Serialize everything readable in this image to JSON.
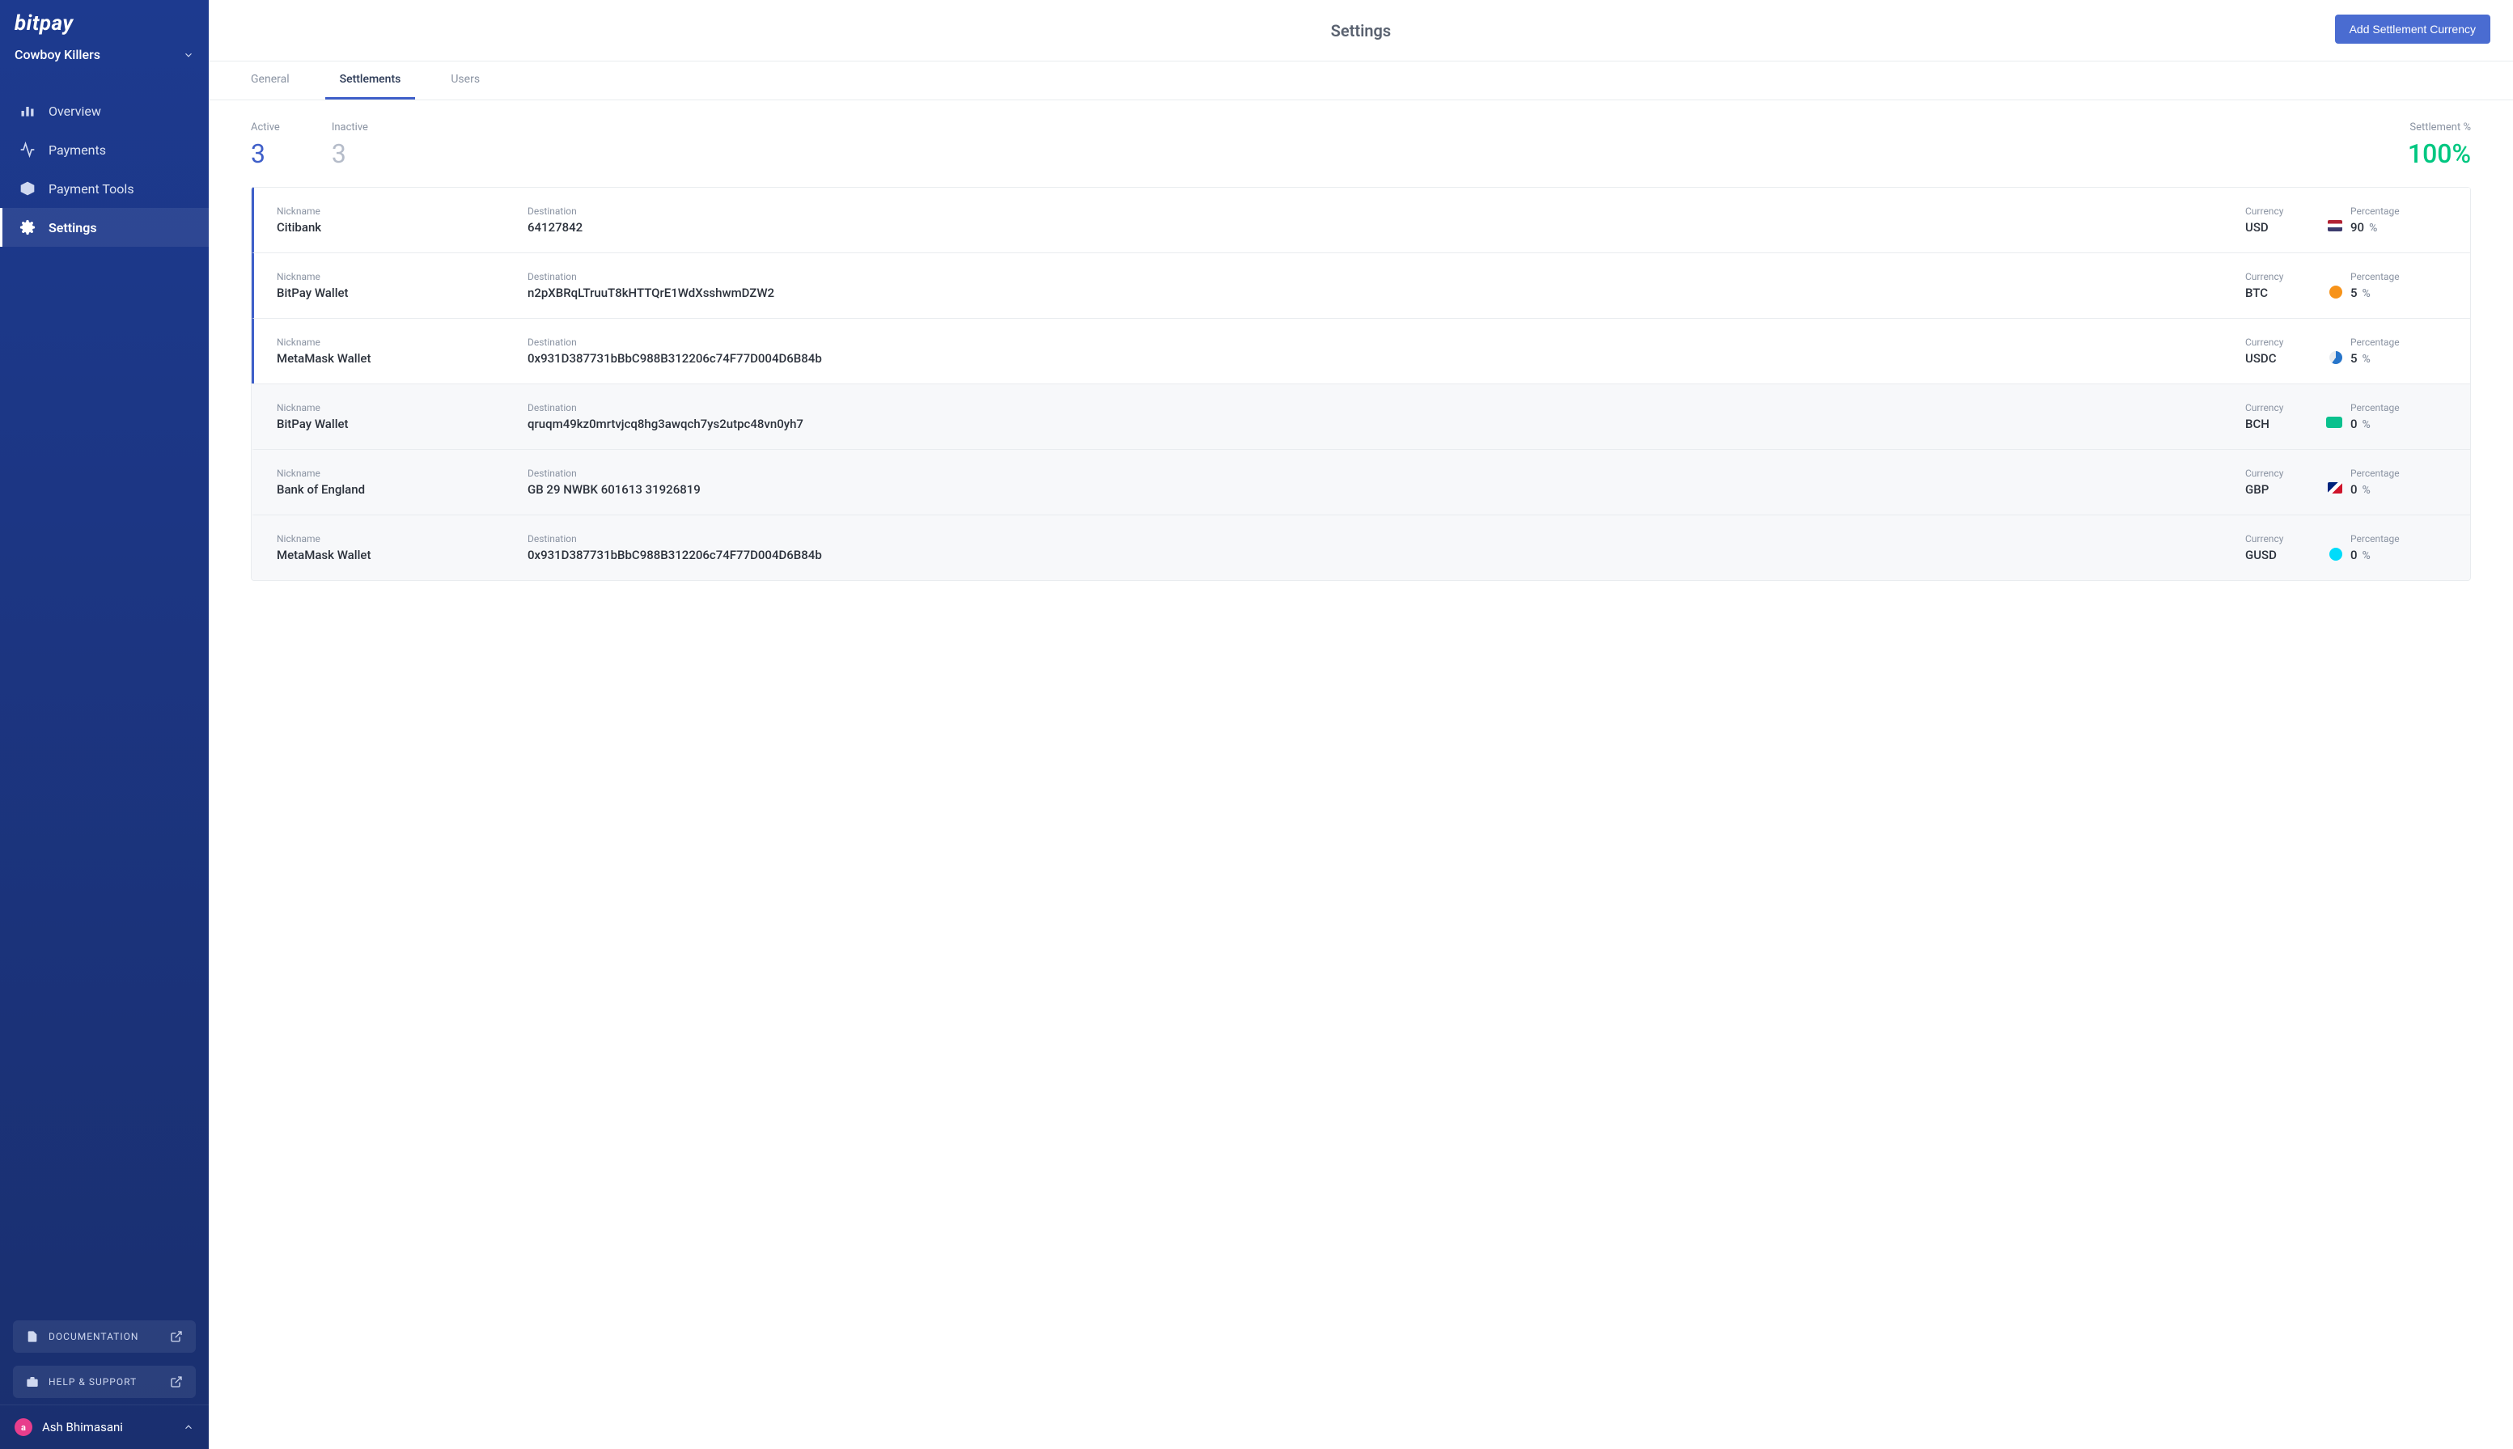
{
  "brand": "bitpay",
  "org": {
    "name": "Cowboy Killers"
  },
  "nav": {
    "overview": "Overview",
    "payments": "Payments",
    "payment_tools": "Payment Tools",
    "settings": "Settings"
  },
  "side": {
    "documentation": "DOCUMENTATION",
    "help": "HELP & SUPPORT"
  },
  "user": {
    "name": "Ash Bhimasani",
    "initial": "a"
  },
  "header": {
    "title": "Settings",
    "primary_button": "Add Settlement Currency"
  },
  "tabs": {
    "general": "General",
    "settlements": "Settlements",
    "users": "Users"
  },
  "stats": {
    "active_label": "Active",
    "active_value": "3",
    "inactive_label": "Inactive",
    "inactive_value": "3",
    "pct_label": "Settlement %",
    "pct_value": "100%"
  },
  "col": {
    "nickname": "Nickname",
    "destination": "Destination",
    "currency": "Currency",
    "percentage": "Percentage",
    "pct_sign": "%"
  },
  "rows": [
    {
      "active": true,
      "nickname": "Citibank",
      "destination": "64127842",
      "currency": "USD",
      "icon": "flag-us",
      "percentage": "90"
    },
    {
      "active": true,
      "nickname": "BitPay Wallet",
      "destination": "n2pXBRqLTruuT8kHTTQrE1WdXsshwmDZW2",
      "currency": "BTC",
      "icon": "ic-btc",
      "percentage": "5"
    },
    {
      "active": true,
      "nickname": "MetaMask Wallet",
      "destination": "0x931D387731bBbC988B312206c74F77D004D6B84b",
      "currency": "USDC",
      "icon": "ic-usdc",
      "percentage": "5"
    },
    {
      "active": false,
      "nickname": "BitPay Wallet",
      "destination": "qruqm49kz0mrtvjcq8hg3awqch7ys2utpc48vn0yh7",
      "currency": "BCH",
      "icon": "ic-bch",
      "percentage": "0"
    },
    {
      "active": false,
      "nickname": "Bank of England",
      "destination": "GB 29 NWBK 601613 31926819",
      "currency": "GBP",
      "icon": "flag-gb",
      "percentage": "0"
    },
    {
      "active": false,
      "nickname": "MetaMask Wallet",
      "destination": "0x931D387731bBbC988B312206c74F77D004D6B84b",
      "currency": "GUSD",
      "icon": "ic-gusd",
      "percentage": "0"
    }
  ]
}
